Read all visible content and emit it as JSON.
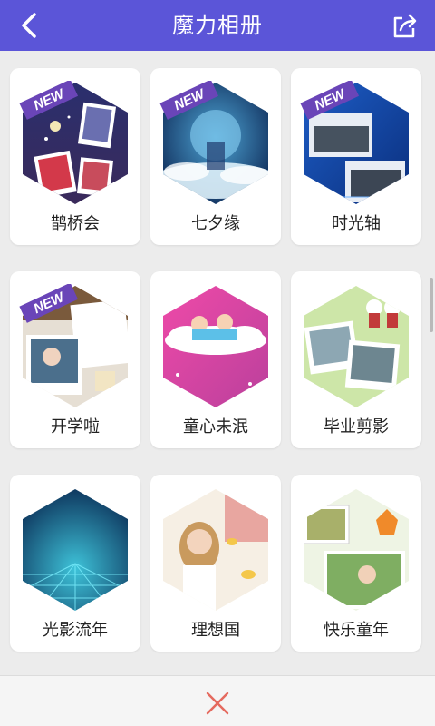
{
  "header": {
    "title": "魔力相册",
    "back_icon": "chevron-left-icon",
    "share_icon": "share-icon",
    "background": "#5b55d8"
  },
  "badge_text": "NEW",
  "templates": [
    {
      "label": "鹊桥会",
      "is_new": true
    },
    {
      "label": "七夕缘",
      "is_new": true
    },
    {
      "label": "时光轴",
      "is_new": true
    },
    {
      "label": "开学啦",
      "is_new": true
    },
    {
      "label": "童心未泯",
      "is_new": false
    },
    {
      "label": "毕业剪影",
      "is_new": false
    },
    {
      "label": "光影流年",
      "is_new": false
    },
    {
      "label": "理想国",
      "is_new": false
    },
    {
      "label": "快乐童年",
      "is_new": false
    }
  ],
  "footer": {
    "close_icon": "close-icon",
    "close_color": "#e56a5f"
  }
}
